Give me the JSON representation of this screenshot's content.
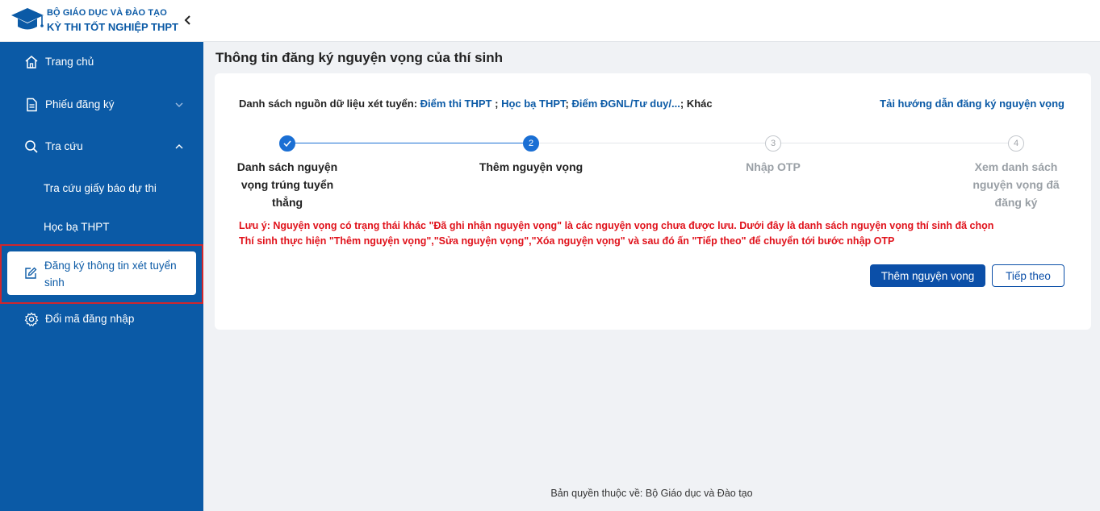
{
  "header": {
    "org_name": "BỘ GIÁO DỤC VÀ ĐÀO TẠO",
    "exam_name": "KỲ THI TỐT NGHIỆP THPT",
    "logo_icon": "graduation-cap-icon",
    "collapse_icon": "chevron-left-icon"
  },
  "sidebar": {
    "items": [
      {
        "label": "Trang chủ",
        "icon": "home-icon"
      },
      {
        "label": "Phiếu đăng ký",
        "icon": "document-icon",
        "caret": "chevron-down-icon"
      },
      {
        "label": "Tra cứu",
        "icon": "search-icon",
        "caret": "chevron-up-icon"
      },
      {
        "label": "Tra cứu giấy báo dự thi"
      },
      {
        "label": "Học bạ THPT"
      },
      {
        "label": "Đăng ký thông tin xét tuyển sinh",
        "icon": "edit-icon",
        "active": true
      },
      {
        "label": "Đổi mã đăng nhập",
        "icon": "gear-icon"
      }
    ]
  },
  "main": {
    "title": "Thông tin đăng ký nguyện vọng của thí sinh",
    "sources": {
      "prefix": "Danh sách nguồn dữ liệu xét tuyển: ",
      "link1": "Điểm thi THPT",
      "sep1": " ; ",
      "link2": "Học bạ THPT",
      "sep2": "; ",
      "link3": "Điểm ĐGNL/Tư duy/...",
      "sep3": "; ",
      "other": "Khác"
    },
    "guide_link": "Tải hướng dẫn đăng ký nguyện vọng",
    "steps": [
      {
        "number": "",
        "label": "Danh sách nguyện vọng trúng tuyển thẳng",
        "state": "done"
      },
      {
        "number": "2",
        "label": "Thêm nguyện vọng",
        "state": "active"
      },
      {
        "number": "3",
        "label": "Nhập OTP",
        "state": "todo"
      },
      {
        "number": "4",
        "label": "Xem danh sách nguyện vọng đã đăng ký",
        "state": "todo"
      }
    ],
    "note_line1": "Lưu ý: Nguyện vọng có trạng thái khác \"Đã ghi nhận nguyện vọng\" là các nguyện vọng chưa được lưu. Dưới đây là danh sách nguyện vọng thí sinh đã chọn",
    "note_line2": "Thí sinh thực hiện \"Thêm nguyện vọng\",\"Sửa nguyện vọng\",\"Xóa nguyện vọng\" và sau đó ấn \"Tiếp theo\" để chuyển tới bước nhập OTP",
    "add_button": "Thêm nguyện vọng",
    "next_button": "Tiếp theo"
  },
  "footer": {
    "copyright": "Bản quyền thuộc về: Bộ Giáo dục và Đào tạo"
  },
  "colors": {
    "brand": "#0b5aa6",
    "primary_button": "#0b4fa8",
    "step_active": "#1a6fd4",
    "warning_text": "#e0121b",
    "highlight_outline": "#d0262c"
  }
}
